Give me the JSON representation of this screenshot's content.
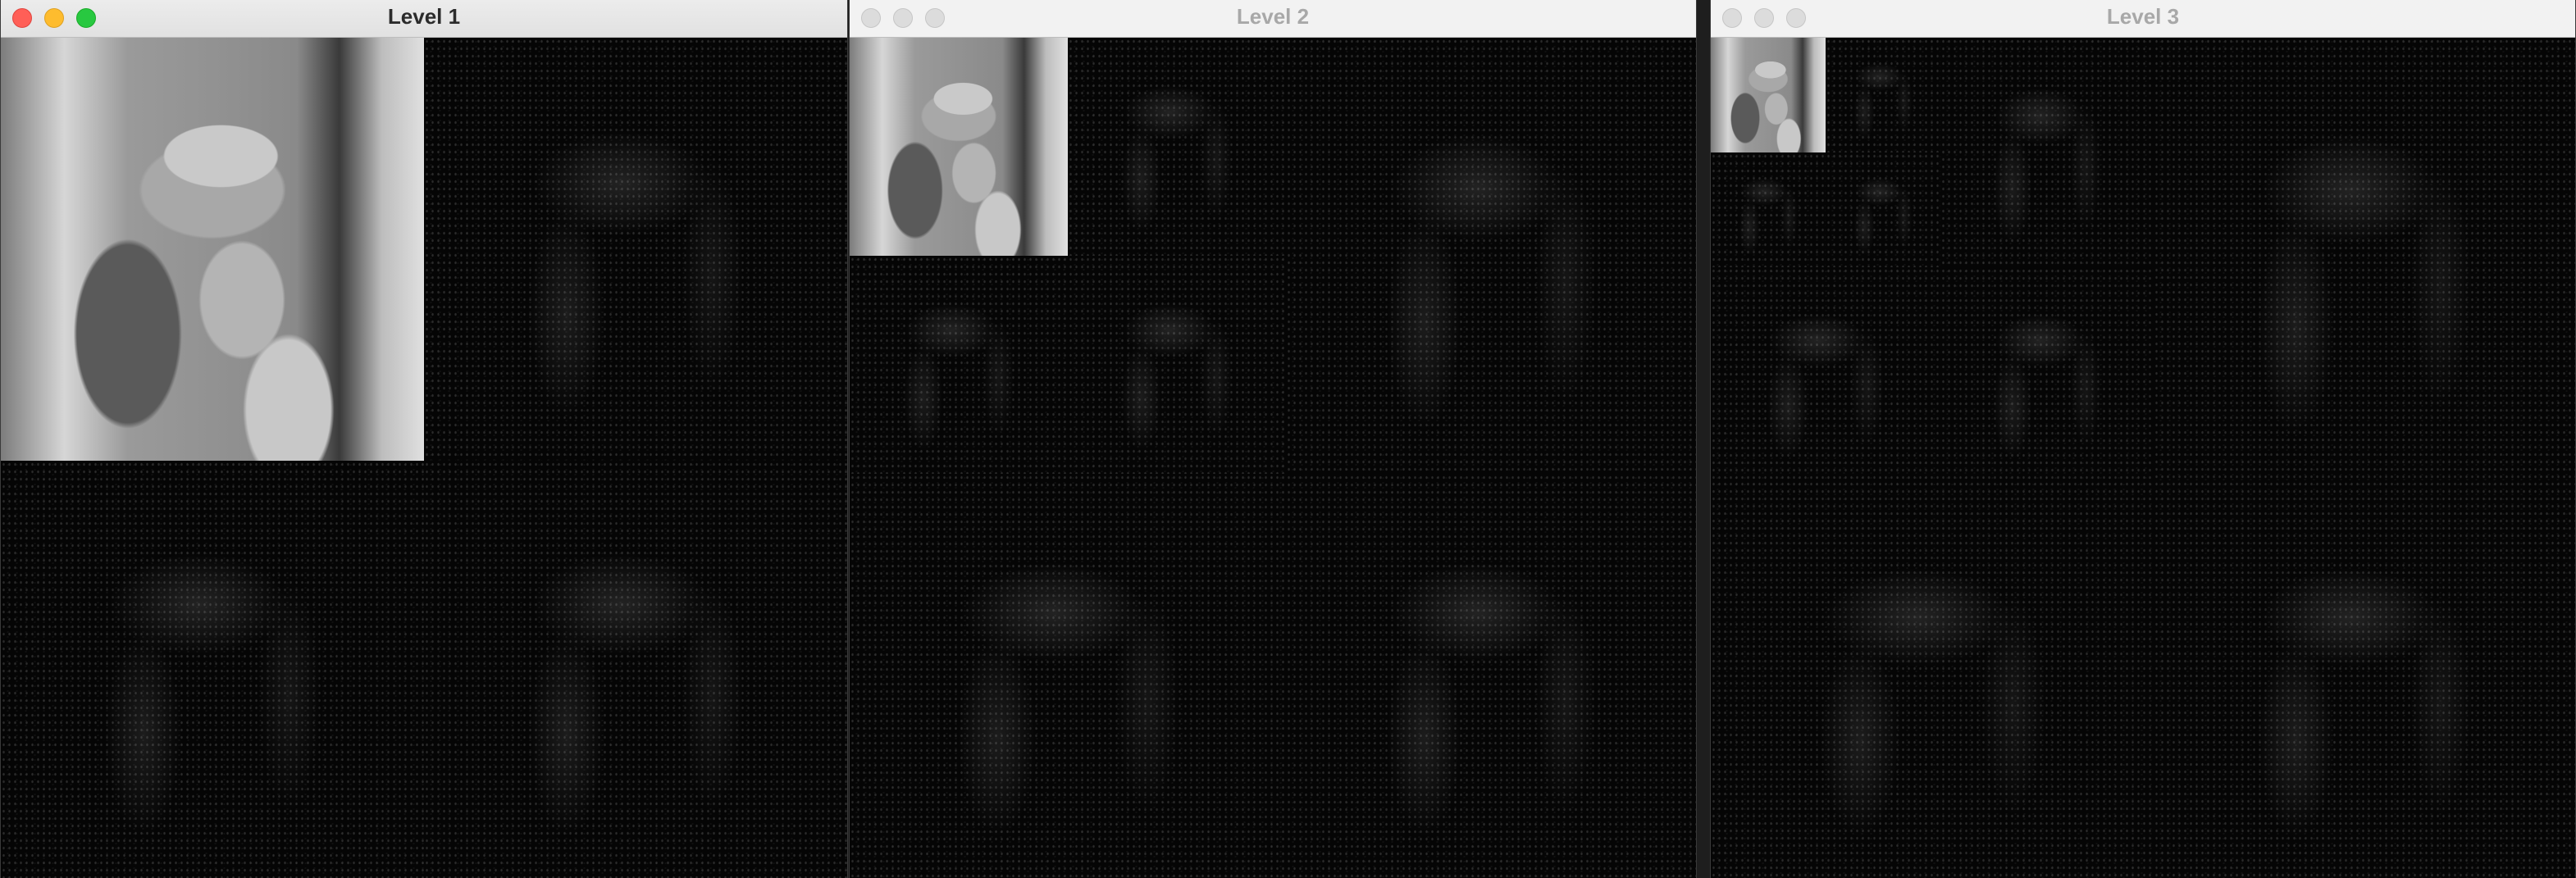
{
  "windows": [
    {
      "title": "Level 1",
      "active": true
    },
    {
      "title": "Level 2",
      "active": false
    },
    {
      "title": "Level 3",
      "active": false
    }
  ]
}
